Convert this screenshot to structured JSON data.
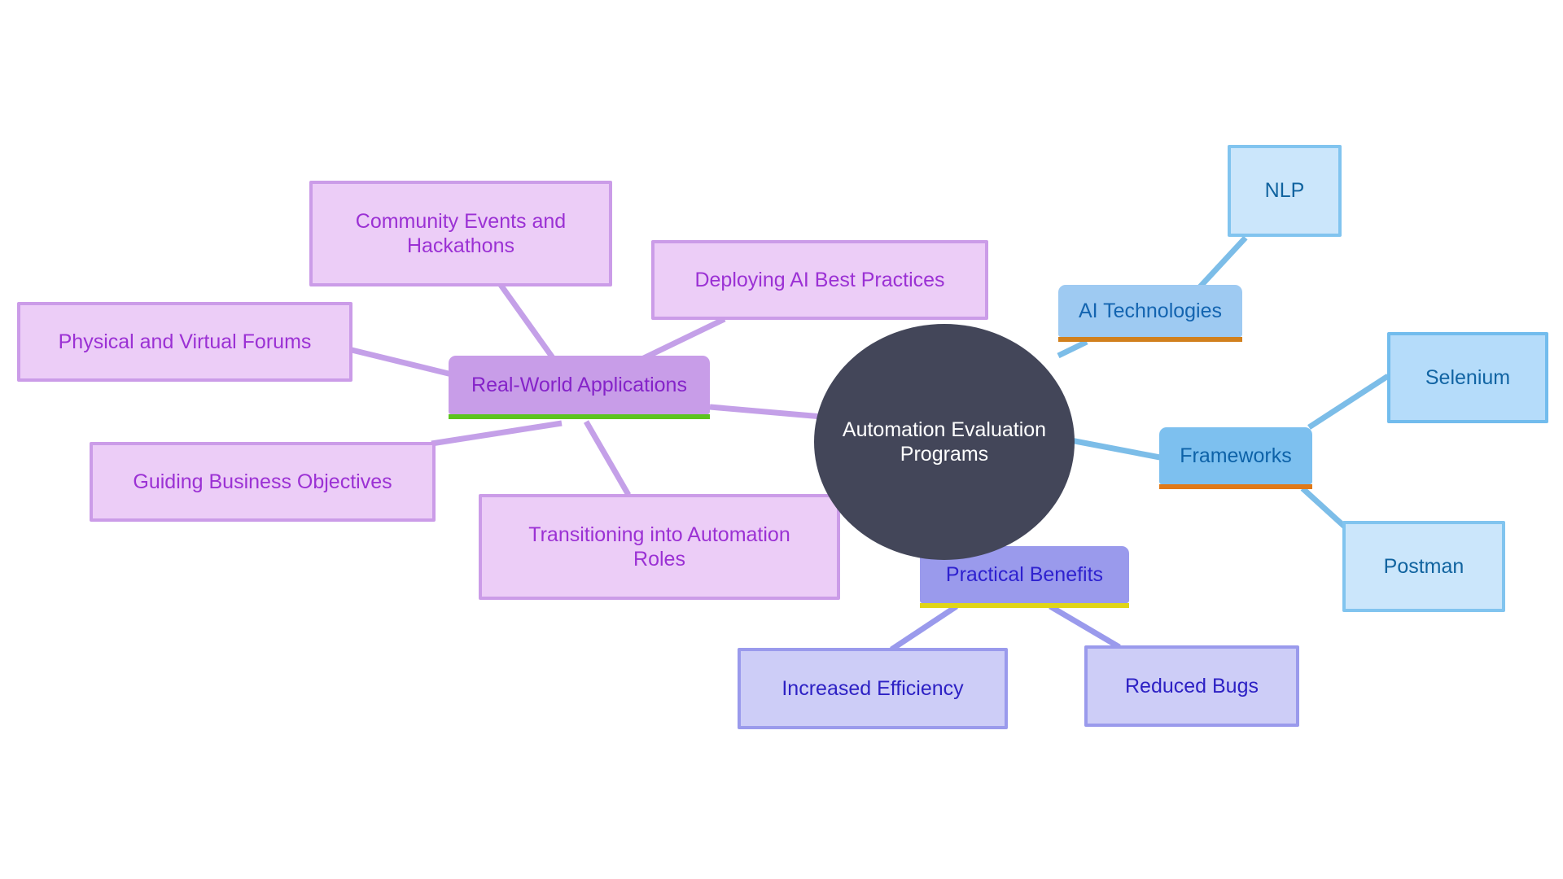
{
  "diagram": {
    "type": "mindmap",
    "title": "Automation Evaluation Programs",
    "background": "#ffffff",
    "root": {
      "id": "root",
      "label": "Automation Evaluation\nPrograms",
      "shape": "circle",
      "fill": "#434659",
      "text_color": "#ffffff"
    },
    "branches": [
      {
        "id": "real-world-applications",
        "label": "Real-World Applications",
        "fill": "#c89de8",
        "text_color": "#8523c9",
        "accent": "#5cc41e",
        "edge_color": "#c4a0e8",
        "children": [
          {
            "id": "community-events-and-hackathons",
            "label": "Community Events and\nHackathons"
          },
          {
            "id": "physical-and-virtual-forums",
            "label": "Physical and Virtual Forums"
          },
          {
            "id": "deploying-ai-best-practices",
            "label": "Deploying AI Best Practices"
          },
          {
            "id": "guiding-business-objectives",
            "label": "Guiding Business Objectives"
          },
          {
            "id": "transitioning-into-automation-roles",
            "label": "Transitioning into Automation\nRoles"
          }
        ]
      },
      {
        "id": "ai-technologies",
        "label": "AI Technologies",
        "fill": "#9ecaf2",
        "text_color": "#1364b0",
        "accent": "#d1801d",
        "edge_color": "#7cbde8",
        "children": [
          {
            "id": "nlp",
            "label": "NLP"
          }
        ]
      },
      {
        "id": "frameworks",
        "label": "Frameworks",
        "fill": "#7dc0ef",
        "text_color": "#0d62a8",
        "accent": "#e07918",
        "edge_color": "#7cbde8",
        "children": [
          {
            "id": "selenium",
            "label": "Selenium"
          },
          {
            "id": "postman",
            "label": "Postman"
          }
        ]
      },
      {
        "id": "practical-benefits",
        "label": "Practical Benefits",
        "fill": "#9a9aec",
        "text_color": "#2e21cf",
        "accent": "#e0d517",
        "edge_color": "#9a9aec",
        "children": [
          {
            "id": "increased-efficiency",
            "label": "Increased Efficiency"
          },
          {
            "id": "reduced-bugs",
            "label": "Reduced Bugs"
          }
        ]
      }
    ],
    "nodes": {
      "root": "Automation Evaluation\nPrograms",
      "real_world_applications": "Real-World Applications",
      "community_events": "Community Events and\nHackathons",
      "physical_virtual_forums": "Physical and Virtual Forums",
      "deploying_ai_best_practices": "Deploying AI Best Practices",
      "guiding_business_objectives": "Guiding Business Objectives",
      "transitioning_automation_roles": "Transitioning into Automation\nRoles",
      "ai_technologies": "AI Technologies",
      "nlp": "NLP",
      "frameworks": "Frameworks",
      "selenium": "Selenium",
      "postman": "Postman",
      "practical_benefits": "Practical Benefits",
      "increased_efficiency": "Increased Efficiency",
      "reduced_bugs": "Reduced Bugs"
    }
  }
}
